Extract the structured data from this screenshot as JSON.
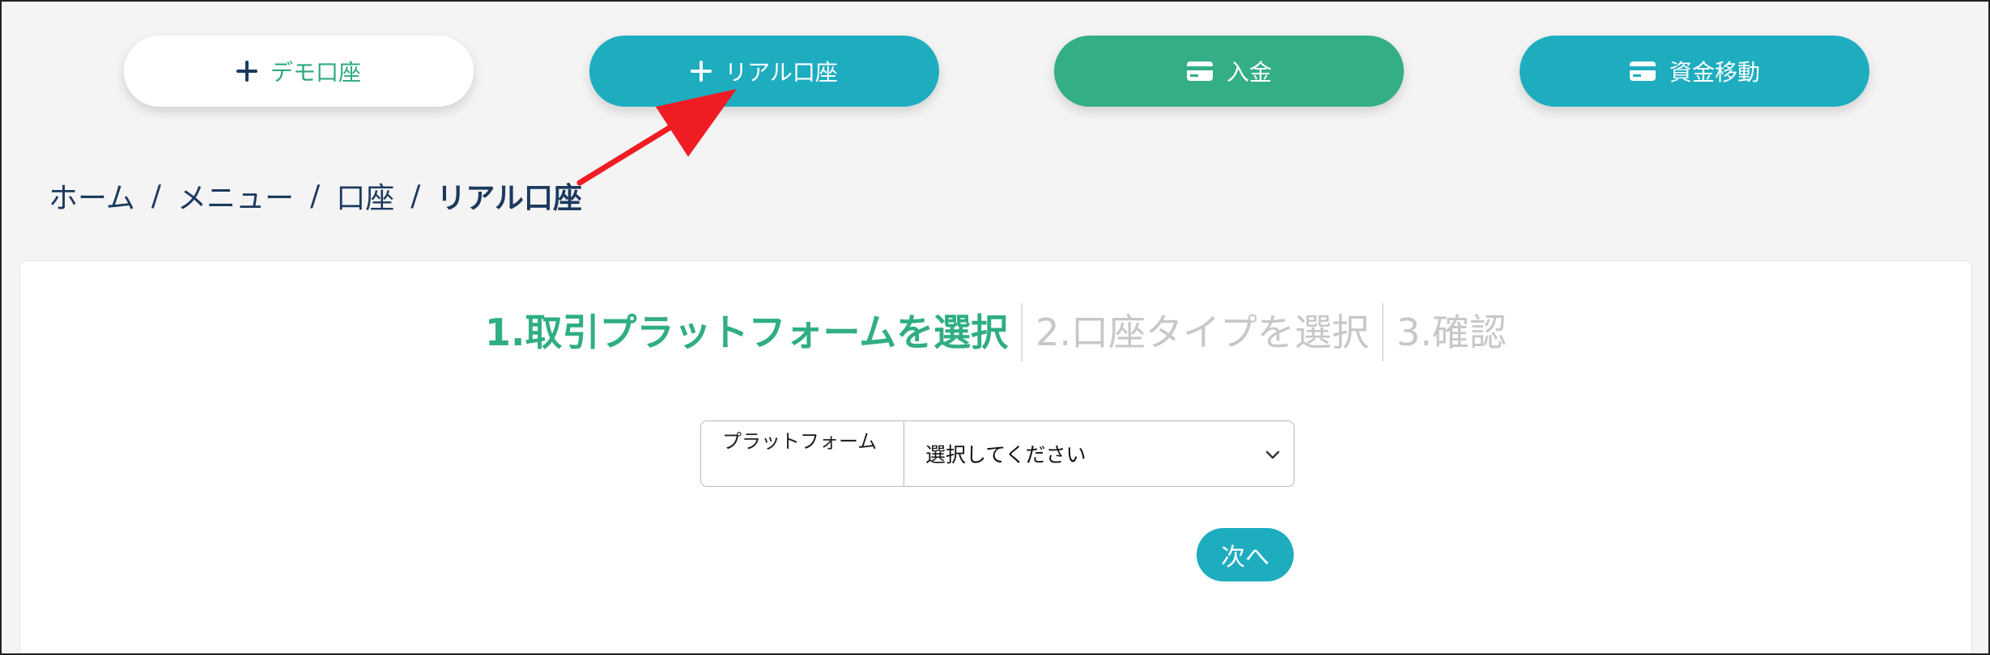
{
  "top_actions": {
    "demo_label": "デモ口座",
    "real_label": "リアル口座",
    "deposit_label": "入金",
    "transfer_label": "資金移動"
  },
  "breadcrumb": {
    "items": [
      "ホーム",
      "メニュー",
      "口座"
    ],
    "separator": "/",
    "current": "リアル口座"
  },
  "steps": [
    {
      "label": "1.取引プラットフォームを選択",
      "active": true
    },
    {
      "label": "2.口座タイプを選択",
      "active": false
    },
    {
      "label": "3.確認",
      "active": false
    }
  ],
  "form": {
    "platform_label": "プラットフォーム",
    "platform_selected": "選択してください"
  },
  "next_label": "次へ",
  "colors": {
    "teal": "#1eadbf",
    "green": "#33ae86",
    "step_active": "#2fae82",
    "step_inactive": "#c7c7c7",
    "navy": "#1c3a5e",
    "annotation_red": "#f01c24"
  },
  "icons": {
    "demo": "plus-icon",
    "real": "plus-icon",
    "deposit": "credit-card-icon",
    "transfer": "credit-card-icon",
    "select": "chevron-down-icon"
  }
}
